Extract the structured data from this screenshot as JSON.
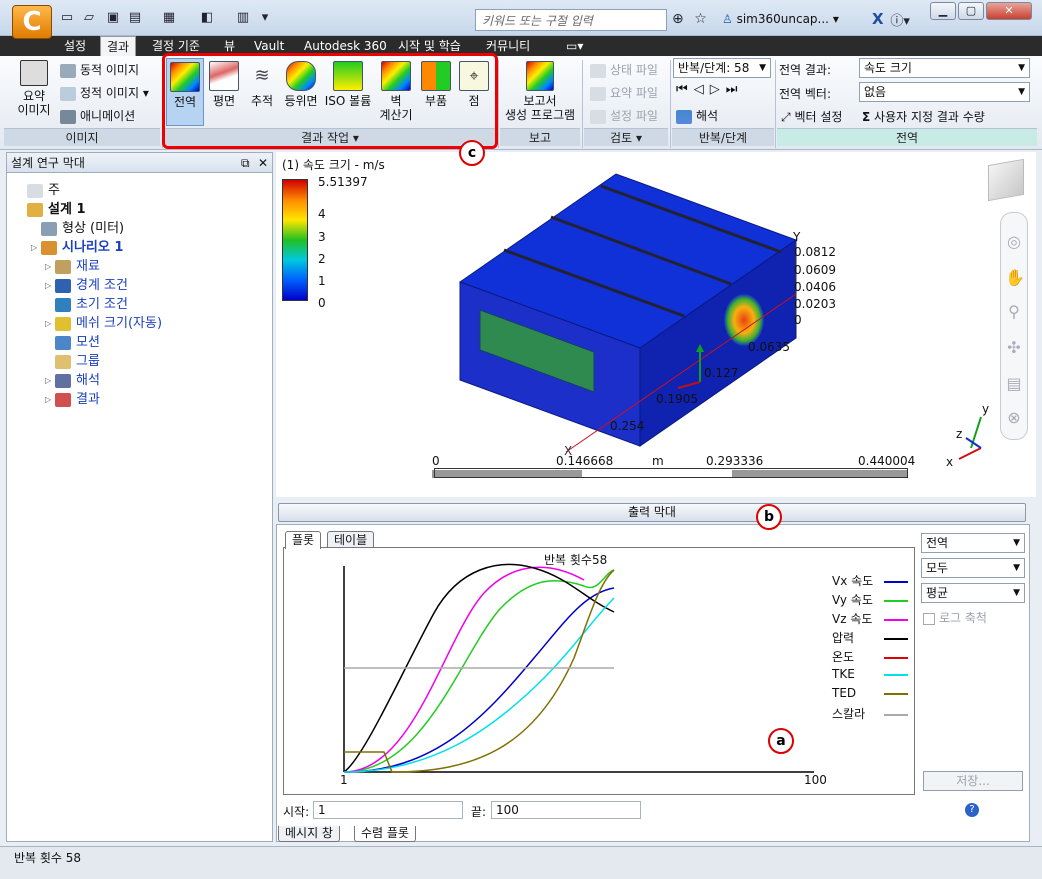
{
  "app": {
    "search_placeholder": "키워드 또는 구절 입력",
    "user": "sim360uncap...",
    "logo_letter": "C"
  },
  "tabs": [
    "설정",
    "결과",
    "결정 기준",
    "뷰",
    "Vault",
    "Autodesk 360",
    "시작 및 학습",
    "커뮤니티"
  ],
  "ribbon": {
    "image_group": {
      "label": "이미지",
      "summary_line1": "요약",
      "summary_line2": "이미지",
      "dynamic": "동적 이미지",
      "static": "정적 이미지",
      "animation": "애니메이션"
    },
    "result_tasks": {
      "label": "결과 작업",
      "buttons": [
        "전역",
        "평면",
        "추적",
        "등위면",
        "ISO 볼륨",
        "벽\n계산기",
        "부품",
        "점"
      ]
    },
    "report": {
      "label": "보고",
      "line1": "보고서",
      "line2": "생성 프로그램"
    },
    "review": {
      "label": "검토",
      "status_file": "상태 파일",
      "summary_file": "요약 파일",
      "settings_file": "설정 파일"
    },
    "iteration": {
      "label": "반복/단계",
      "value": "반복/단계: 58",
      "analysis": "해석"
    },
    "global": {
      "label": "전역",
      "result_label": "전역 결과:",
      "result_value": "속도 크기",
      "vector_label": "전역 벡터:",
      "vector_value": "없음",
      "vector_settings": "벡터 설정",
      "custom_quantity": "사용자 지정 결과 수량"
    }
  },
  "design_panel": {
    "title": "설계 연구 막대",
    "items": [
      {
        "label": "주",
        "indent": 0,
        "bold": false,
        "blue": false,
        "tri": false
      },
      {
        "label": "설계 1",
        "indent": 0,
        "bold": true,
        "blue": false,
        "tri": false
      },
      {
        "label": "형상 (미터)",
        "indent": 1,
        "bold": false,
        "blue": false,
        "tri": false
      },
      {
        "label": "시나리오 1",
        "indent": 1,
        "bold": true,
        "blue": true,
        "tri": true
      },
      {
        "label": "재료",
        "indent": 2,
        "bold": false,
        "blue": true,
        "tri": true
      },
      {
        "label": "경계 조건",
        "indent": 2,
        "bold": false,
        "blue": true,
        "tri": true
      },
      {
        "label": "초기 조건",
        "indent": 2,
        "bold": false,
        "blue": true,
        "tri": false
      },
      {
        "label": "메쉬 크기(자동)",
        "indent": 2,
        "bold": false,
        "blue": true,
        "tri": true
      },
      {
        "label": "모션",
        "indent": 2,
        "bold": false,
        "blue": true,
        "tri": false
      },
      {
        "label": "그룹",
        "indent": 2,
        "bold": false,
        "blue": true,
        "tri": false
      },
      {
        "label": "해석",
        "indent": 2,
        "bold": false,
        "blue": true,
        "tri": true
      },
      {
        "label": "결과",
        "indent": 2,
        "bold": false,
        "blue": true,
        "tri": true
      }
    ]
  },
  "viewport": {
    "legend_title": "(1) 속도 크기 - m/s",
    "legend_max": "5.51397",
    "legend_ticks": [
      "4",
      "3",
      "2",
      "1",
      "0"
    ],
    "y_ticks": [
      "0.0812",
      "0.0609",
      "0.0406",
      "0.0203",
      "0"
    ],
    "x_ticks": [
      "0.0635",
      "0.127",
      "0.1905",
      "0.254"
    ],
    "axis_y": "Y",
    "axis_x": "X",
    "scale": {
      "left": "0",
      "mid1": "0.146668",
      "unit": "m",
      "mid2": "0.293336",
      "right": "0.440004"
    },
    "triad": {
      "x": "x",
      "y": "y",
      "z": "z"
    }
  },
  "output": {
    "bar_title": "출력 막대",
    "tabs": [
      "플롯",
      "테이블"
    ],
    "plot_title": "반복 횟수58",
    "x_start": "1",
    "x_end": "100",
    "series": [
      {
        "name": "Vx 속도",
        "color": "#0000cc"
      },
      {
        "name": "Vy 속도",
        "color": "#22cc22"
      },
      {
        "name": "Vz 속도",
        "color": "#ee00ee"
      },
      {
        "name": "압력",
        "color": "#000000"
      },
      {
        "name": "온도",
        "color": "#dd0000"
      },
      {
        "name": "TKE",
        "color": "#00e0e8"
      },
      {
        "name": "TED",
        "color": "#807000"
      },
      {
        "name": "스칼라",
        "color": "#aaaaaa"
      }
    ],
    "dropdowns": [
      "전역",
      "모두",
      "평균"
    ],
    "log_scale": "로그 축척",
    "save": "저장...",
    "start_label": "시작:",
    "start_value": "1",
    "end_label": "끝:",
    "end_value": "100",
    "bottom_tabs": [
      "메시지 창",
      "수렴 플롯"
    ]
  },
  "callouts": {
    "a": "a",
    "b": "b",
    "c": "c"
  },
  "status": "반복 횟수 58"
}
